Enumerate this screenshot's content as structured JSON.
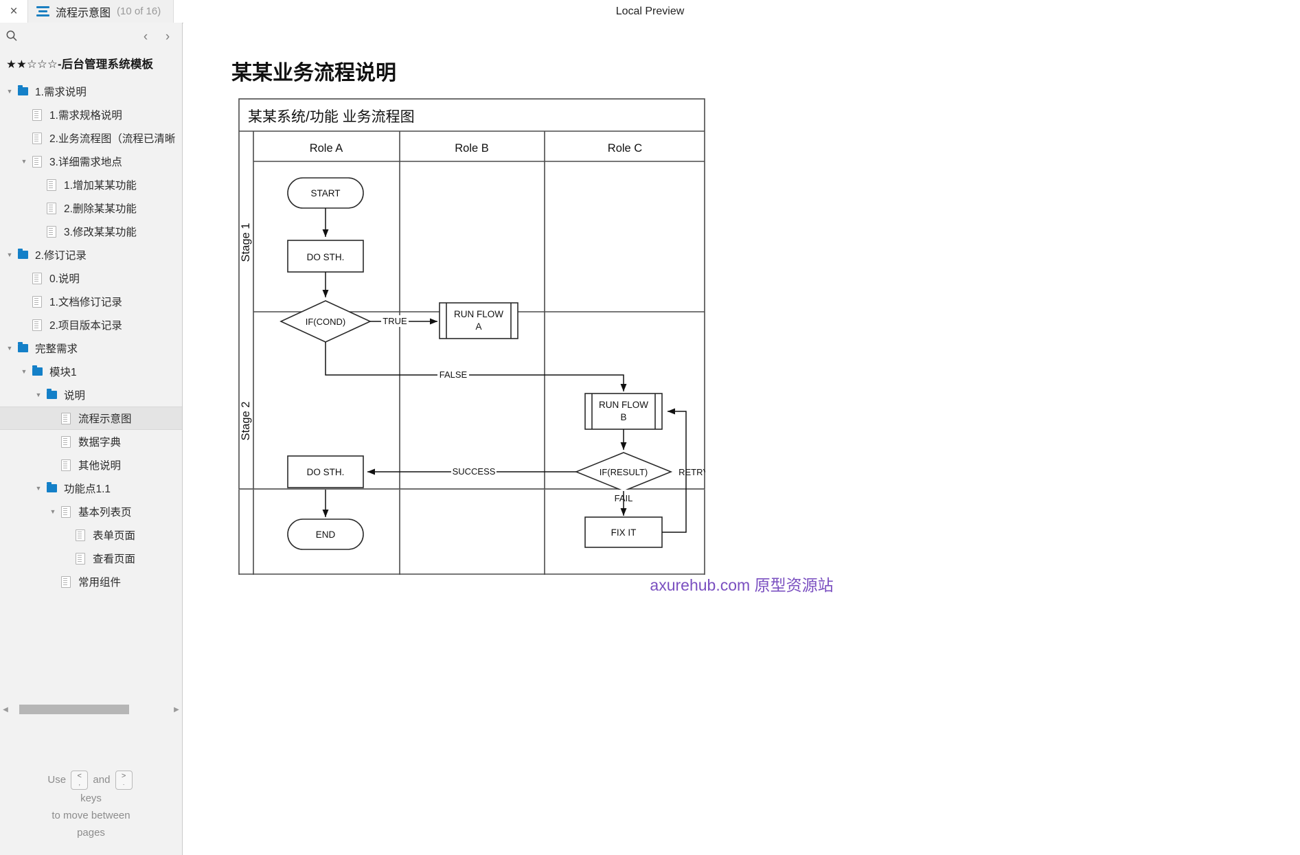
{
  "window": {
    "close_label": "×",
    "tab_title": "流程示意图",
    "tab_count": "(10 of 16)",
    "center_label": "Local Preview"
  },
  "sidebar": {
    "search_icon": "search-icon",
    "prev_label": "‹",
    "next_label": "›",
    "project_title": "★★☆☆☆-后台管理系统模板",
    "items": [
      {
        "label": "1.需求说明",
        "icon": "folder",
        "depth": 0,
        "caret": "▼",
        "selected": false
      },
      {
        "label": "1.需求规格说明",
        "icon": "page",
        "depth": 1,
        "caret": "",
        "selected": false
      },
      {
        "label": "2.业务流程图（流程已清晰",
        "icon": "page",
        "depth": 1,
        "caret": "",
        "selected": false
      },
      {
        "label": "3.详细需求地点",
        "icon": "page",
        "depth": 1,
        "caret": "▼",
        "selected": false
      },
      {
        "label": "1.增加某某功能",
        "icon": "page",
        "depth": 2,
        "caret": "",
        "selected": false
      },
      {
        "label": "2.删除某某功能",
        "icon": "page",
        "depth": 2,
        "caret": "",
        "selected": false
      },
      {
        "label": "3.修改某某功能",
        "icon": "page",
        "depth": 2,
        "caret": "",
        "selected": false
      },
      {
        "label": "2.修订记录",
        "icon": "folder",
        "depth": 0,
        "caret": "▼",
        "selected": false
      },
      {
        "label": "0.说明",
        "icon": "page",
        "depth": 1,
        "caret": "",
        "selected": false
      },
      {
        "label": "1.文档修订记录",
        "icon": "page",
        "depth": 1,
        "caret": "",
        "selected": false
      },
      {
        "label": "2.项目版本记录",
        "icon": "page",
        "depth": 1,
        "caret": "",
        "selected": false
      },
      {
        "label": "完整需求",
        "icon": "folder",
        "depth": 0,
        "caret": "▼",
        "selected": false
      },
      {
        "label": "模块1",
        "icon": "folder",
        "depth": 1,
        "caret": "▼",
        "selected": false
      },
      {
        "label": "说明",
        "icon": "folder",
        "depth": 2,
        "caret": "▼",
        "selected": false
      },
      {
        "label": "流程示意图",
        "icon": "page",
        "depth": 3,
        "caret": "",
        "selected": true
      },
      {
        "label": "数据字典",
        "icon": "page",
        "depth": 3,
        "caret": "",
        "selected": false
      },
      {
        "label": "其他说明",
        "icon": "page",
        "depth": 3,
        "caret": "",
        "selected": false
      },
      {
        "label": "功能点1.1",
        "icon": "folder",
        "depth": 2,
        "caret": "▼",
        "selected": false
      },
      {
        "label": "基本列表页",
        "icon": "page",
        "depth": 3,
        "caret": "▼",
        "selected": false
      },
      {
        "label": "表单页面",
        "icon": "page",
        "depth": 4,
        "caret": "",
        "selected": false
      },
      {
        "label": "查看页面",
        "icon": "page",
        "depth": 4,
        "caret": "",
        "selected": false
      },
      {
        "label": "常用组件",
        "icon": "page",
        "depth": 3,
        "caret": "",
        "selected": false
      }
    ],
    "hscroll_left": "◀",
    "hscroll_right": "▶",
    "hint": {
      "use": "Use",
      "key_prev_top": "<",
      "key_prev_bottom": ",",
      "and": "and",
      "key_next_top": ">",
      "key_next_bottom": ".",
      "line2": "keys",
      "line3": "to move between",
      "line4": "pages"
    }
  },
  "main": {
    "page_title": "某某业务流程说明",
    "footer_site": "axurehub.com",
    "footer_cn": "原型资源站"
  },
  "chart_data": {
    "type": "diagram",
    "subtype": "swimlane-flowchart",
    "title": "某某系统/功能 业务流程图",
    "lanes_x": [
      "Role A",
      "Role B",
      "Role C"
    ],
    "lanes_y": [
      "Stage 1",
      "Stage 2"
    ],
    "nodes": [
      {
        "id": "start",
        "label": "START",
        "shape": "terminator",
        "lane": "Role A",
        "stage": "Stage 1"
      },
      {
        "id": "do1",
        "label": "DO  STH.",
        "shape": "process",
        "lane": "Role A",
        "stage": "Stage 1"
      },
      {
        "id": "ifcond",
        "label": "IF(COND)",
        "shape": "decision",
        "lane": "Role A",
        "stage": "Stage 1"
      },
      {
        "id": "flowa",
        "label": "RUN FLOW A",
        "shape": "predefined-process",
        "lane": "Role B",
        "stage": "Stage 1"
      },
      {
        "id": "flowb",
        "label": "RUN FLOW B",
        "shape": "predefined-process",
        "lane": "Role C",
        "stage": "Stage 2"
      },
      {
        "id": "ifres",
        "label": "IF(RESULT)",
        "shape": "decision",
        "lane": "Role C",
        "stage": "Stage 2"
      },
      {
        "id": "fixit",
        "label": "FIX IT",
        "shape": "process",
        "lane": "Role C",
        "stage": "Stage 2"
      },
      {
        "id": "do2",
        "label": "DO  STH.",
        "shape": "process",
        "lane": "Role A",
        "stage": "Stage 2"
      },
      {
        "id": "end",
        "label": "END",
        "shape": "terminator",
        "lane": "Role A",
        "stage": "Stage 2"
      }
    ],
    "edges": [
      {
        "from": "start",
        "to": "do1",
        "label": ""
      },
      {
        "from": "do1",
        "to": "ifcond",
        "label": ""
      },
      {
        "from": "ifcond",
        "to": "flowa",
        "label": "TRUE"
      },
      {
        "from": "ifcond",
        "to": "flowb",
        "label": "FALSE"
      },
      {
        "from": "flowb",
        "to": "ifres",
        "label": ""
      },
      {
        "from": "ifres",
        "to": "do2",
        "label": "SUCCESS"
      },
      {
        "from": "ifres",
        "to": "fixit",
        "label": "FAIL"
      },
      {
        "from": "fixit",
        "to": "flowb",
        "label": "RETRY"
      },
      {
        "from": "do2",
        "to": "end",
        "label": ""
      }
    ],
    "labels": {
      "start": "START",
      "do_sth_1": "DO  STH.",
      "if_cond": "IF(COND)",
      "true": "TRUE",
      "false": "FALSE",
      "run_flow_a_l1": "RUN FLOW",
      "run_flow_a_l2": "A",
      "run_flow_b_l1": "RUN FLOW",
      "run_flow_b_l2": "B",
      "if_result": "IF(RESULT)",
      "retry": "RETRY",
      "fail": "FAIL",
      "fix_it": "FIX IT",
      "success": "SUCCESS",
      "do_sth_2": "DO  STH.",
      "end": "END",
      "role_a": "Role A",
      "role_b": "Role B",
      "role_c": "Role C",
      "stage_1": "Stage 1",
      "stage_2": "Stage 2"
    }
  }
}
